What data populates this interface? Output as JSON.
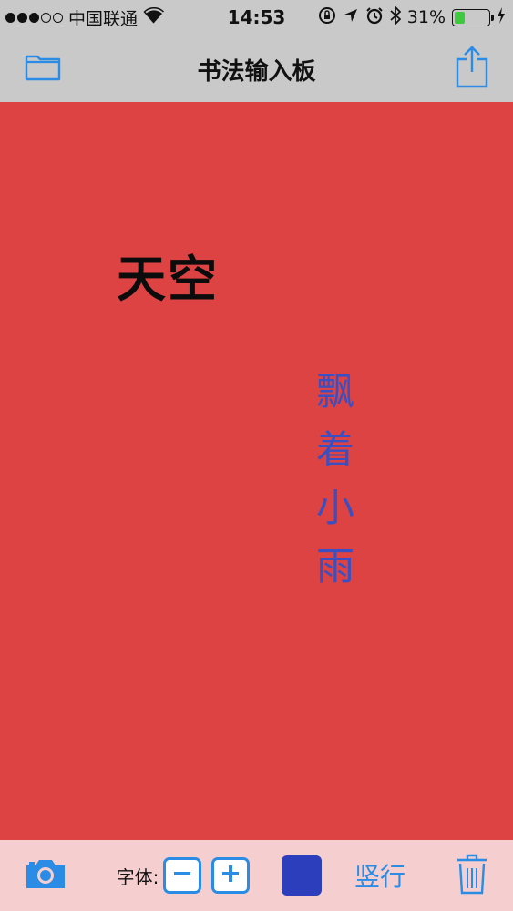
{
  "status_bar": {
    "signal_dots": 5,
    "signal_filled": 3,
    "carrier": "中国联通",
    "time": "14:53",
    "battery_percent": "31%",
    "battery_level": 0.31,
    "icons": [
      "wifi-icon",
      "rotation-lock-icon",
      "location-icon",
      "alarm-icon",
      "bluetooth-icon",
      "battery-icon",
      "charging-icon"
    ]
  },
  "nav": {
    "title": "书法输入板",
    "left_icon": "folder-icon",
    "right_icon": "share-icon"
  },
  "canvas": {
    "background": "#dc4342",
    "horizontal_text": "天空",
    "horizontal_color": "#0c0c0c",
    "vertical_text": "飘着小雨",
    "vertical_color": "#3a4fc2"
  },
  "toolbar": {
    "camera_icon": "camera-icon",
    "font_label": "字体:",
    "decrease_icon": "minus-icon",
    "increase_icon": "plus-icon",
    "ink_color": "#2c3ebc",
    "orientation_label": "竖行",
    "delete_icon": "trash-icon"
  },
  "colors": {
    "accent": "#2a8ce4",
    "bar_gray": "#c9c9c9",
    "toolbar_bg": "#f5cfd0"
  }
}
